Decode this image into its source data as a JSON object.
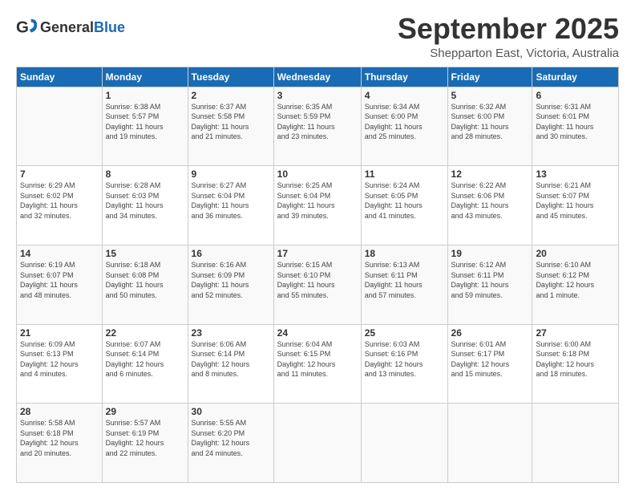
{
  "header": {
    "logo_general": "General",
    "logo_blue": "Blue",
    "month_title": "September 2025",
    "location": "Shepparton East, Victoria, Australia"
  },
  "calendar": {
    "days_of_week": [
      "Sunday",
      "Monday",
      "Tuesday",
      "Wednesday",
      "Thursday",
      "Friday",
      "Saturday"
    ],
    "weeks": [
      [
        {
          "day": "",
          "info": ""
        },
        {
          "day": "1",
          "info": "Sunrise: 6:38 AM\nSunset: 5:57 PM\nDaylight: 11 hours\nand 19 minutes."
        },
        {
          "day": "2",
          "info": "Sunrise: 6:37 AM\nSunset: 5:58 PM\nDaylight: 11 hours\nand 21 minutes."
        },
        {
          "day": "3",
          "info": "Sunrise: 6:35 AM\nSunset: 5:59 PM\nDaylight: 11 hours\nand 23 minutes."
        },
        {
          "day": "4",
          "info": "Sunrise: 6:34 AM\nSunset: 6:00 PM\nDaylight: 11 hours\nand 25 minutes."
        },
        {
          "day": "5",
          "info": "Sunrise: 6:32 AM\nSunset: 6:00 PM\nDaylight: 11 hours\nand 28 minutes."
        },
        {
          "day": "6",
          "info": "Sunrise: 6:31 AM\nSunset: 6:01 PM\nDaylight: 11 hours\nand 30 minutes."
        }
      ],
      [
        {
          "day": "7",
          "info": "Sunrise: 6:29 AM\nSunset: 6:02 PM\nDaylight: 11 hours\nand 32 minutes."
        },
        {
          "day": "8",
          "info": "Sunrise: 6:28 AM\nSunset: 6:03 PM\nDaylight: 11 hours\nand 34 minutes."
        },
        {
          "day": "9",
          "info": "Sunrise: 6:27 AM\nSunset: 6:04 PM\nDaylight: 11 hours\nand 36 minutes."
        },
        {
          "day": "10",
          "info": "Sunrise: 6:25 AM\nSunset: 6:04 PM\nDaylight: 11 hours\nand 39 minutes."
        },
        {
          "day": "11",
          "info": "Sunrise: 6:24 AM\nSunset: 6:05 PM\nDaylight: 11 hours\nand 41 minutes."
        },
        {
          "day": "12",
          "info": "Sunrise: 6:22 AM\nSunset: 6:06 PM\nDaylight: 11 hours\nand 43 minutes."
        },
        {
          "day": "13",
          "info": "Sunrise: 6:21 AM\nSunset: 6:07 PM\nDaylight: 11 hours\nand 45 minutes."
        }
      ],
      [
        {
          "day": "14",
          "info": "Sunrise: 6:19 AM\nSunset: 6:07 PM\nDaylight: 11 hours\nand 48 minutes."
        },
        {
          "day": "15",
          "info": "Sunrise: 6:18 AM\nSunset: 6:08 PM\nDaylight: 11 hours\nand 50 minutes."
        },
        {
          "day": "16",
          "info": "Sunrise: 6:16 AM\nSunset: 6:09 PM\nDaylight: 11 hours\nand 52 minutes."
        },
        {
          "day": "17",
          "info": "Sunrise: 6:15 AM\nSunset: 6:10 PM\nDaylight: 11 hours\nand 55 minutes."
        },
        {
          "day": "18",
          "info": "Sunrise: 6:13 AM\nSunset: 6:11 PM\nDaylight: 11 hours\nand 57 minutes."
        },
        {
          "day": "19",
          "info": "Sunrise: 6:12 AM\nSunset: 6:11 PM\nDaylight: 11 hours\nand 59 minutes."
        },
        {
          "day": "20",
          "info": "Sunrise: 6:10 AM\nSunset: 6:12 PM\nDaylight: 12 hours\nand 1 minute."
        }
      ],
      [
        {
          "day": "21",
          "info": "Sunrise: 6:09 AM\nSunset: 6:13 PM\nDaylight: 12 hours\nand 4 minutes."
        },
        {
          "day": "22",
          "info": "Sunrise: 6:07 AM\nSunset: 6:14 PM\nDaylight: 12 hours\nand 6 minutes."
        },
        {
          "day": "23",
          "info": "Sunrise: 6:06 AM\nSunset: 6:14 PM\nDaylight: 12 hours\nand 8 minutes."
        },
        {
          "day": "24",
          "info": "Sunrise: 6:04 AM\nSunset: 6:15 PM\nDaylight: 12 hours\nand 11 minutes."
        },
        {
          "day": "25",
          "info": "Sunrise: 6:03 AM\nSunset: 6:16 PM\nDaylight: 12 hours\nand 13 minutes."
        },
        {
          "day": "26",
          "info": "Sunrise: 6:01 AM\nSunset: 6:17 PM\nDaylight: 12 hours\nand 15 minutes."
        },
        {
          "day": "27",
          "info": "Sunrise: 6:00 AM\nSunset: 6:18 PM\nDaylight: 12 hours\nand 18 minutes."
        }
      ],
      [
        {
          "day": "28",
          "info": "Sunrise: 5:58 AM\nSunset: 6:18 PM\nDaylight: 12 hours\nand 20 minutes."
        },
        {
          "day": "29",
          "info": "Sunrise: 5:57 AM\nSunset: 6:19 PM\nDaylight: 12 hours\nand 22 minutes."
        },
        {
          "day": "30",
          "info": "Sunrise: 5:55 AM\nSunset: 6:20 PM\nDaylight: 12 hours\nand 24 minutes."
        },
        {
          "day": "",
          "info": ""
        },
        {
          "day": "",
          "info": ""
        },
        {
          "day": "",
          "info": ""
        },
        {
          "day": "",
          "info": ""
        }
      ]
    ]
  }
}
